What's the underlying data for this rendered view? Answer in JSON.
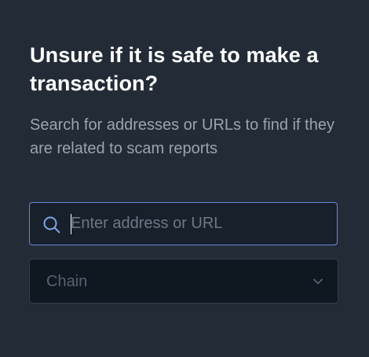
{
  "header": {
    "title": "Unsure if it is safe to make a transaction?",
    "subtitle": "Search for addresses or URLs to find if they are related to scam reports"
  },
  "search": {
    "placeholder": "Enter address or URL",
    "value": "",
    "icon": "search-icon"
  },
  "chain_select": {
    "placeholder": "Chain",
    "icon": "chevron-down-icon"
  },
  "colors": {
    "background": "#232b37",
    "input_background": "#18202b",
    "input_focus_border": "#6b87d6",
    "select_background": "#0f1720",
    "title_text": "#ffffff",
    "subtitle_text": "#9aa3ae",
    "placeholder_text": "#6c7886"
  }
}
